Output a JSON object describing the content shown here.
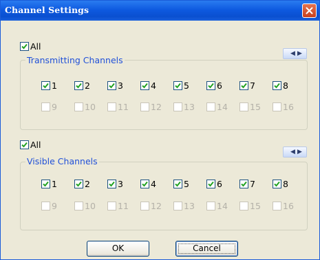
{
  "window": {
    "title": "Channel Settings"
  },
  "transmitting": {
    "all_label": "All",
    "group_title": "Transmitting Channels",
    "row1": [
      {
        "label": "1",
        "checked": true
      },
      {
        "label": "2",
        "checked": true
      },
      {
        "label": "3",
        "checked": true
      },
      {
        "label": "4",
        "checked": true
      },
      {
        "label": "5",
        "checked": true
      },
      {
        "label": "6",
        "checked": true
      },
      {
        "label": "7",
        "checked": true
      },
      {
        "label": "8",
        "checked": true
      }
    ],
    "row2": [
      {
        "label": "9",
        "checked": false
      },
      {
        "label": "10",
        "checked": false
      },
      {
        "label": "11",
        "checked": false
      },
      {
        "label": "12",
        "checked": false
      },
      {
        "label": "13",
        "checked": false
      },
      {
        "label": "14",
        "checked": false
      },
      {
        "label": "15",
        "checked": false
      },
      {
        "label": "16",
        "checked": false
      }
    ]
  },
  "visible": {
    "all_label": "All",
    "group_title": "Visible Channels",
    "row1": [
      {
        "label": "1",
        "checked": true
      },
      {
        "label": "2",
        "checked": true
      },
      {
        "label": "3",
        "checked": true
      },
      {
        "label": "4",
        "checked": true
      },
      {
        "label": "5",
        "checked": true
      },
      {
        "label": "6",
        "checked": true
      },
      {
        "label": "7",
        "checked": true
      },
      {
        "label": "8",
        "checked": true
      }
    ],
    "row2": [
      {
        "label": "9",
        "checked": false
      },
      {
        "label": "10",
        "checked": false
      },
      {
        "label": "11",
        "checked": false
      },
      {
        "label": "12",
        "checked": false
      },
      {
        "label": "13",
        "checked": false
      },
      {
        "label": "14",
        "checked": false
      },
      {
        "label": "15",
        "checked": false
      },
      {
        "label": "16",
        "checked": false
      }
    ]
  },
  "buttons": {
    "ok": "OK",
    "cancel": "Cancel"
  },
  "icons": {
    "close": "close-icon",
    "scroll_left": "chevron-left-icon",
    "scroll_right": "chevron-right-icon",
    "check": "checkmark-icon"
  },
  "colors": {
    "titlebar": "#0e5ae0",
    "group_title": "#2050d8",
    "dialog_bg": "#ece9d8",
    "check": "#21a121"
  }
}
